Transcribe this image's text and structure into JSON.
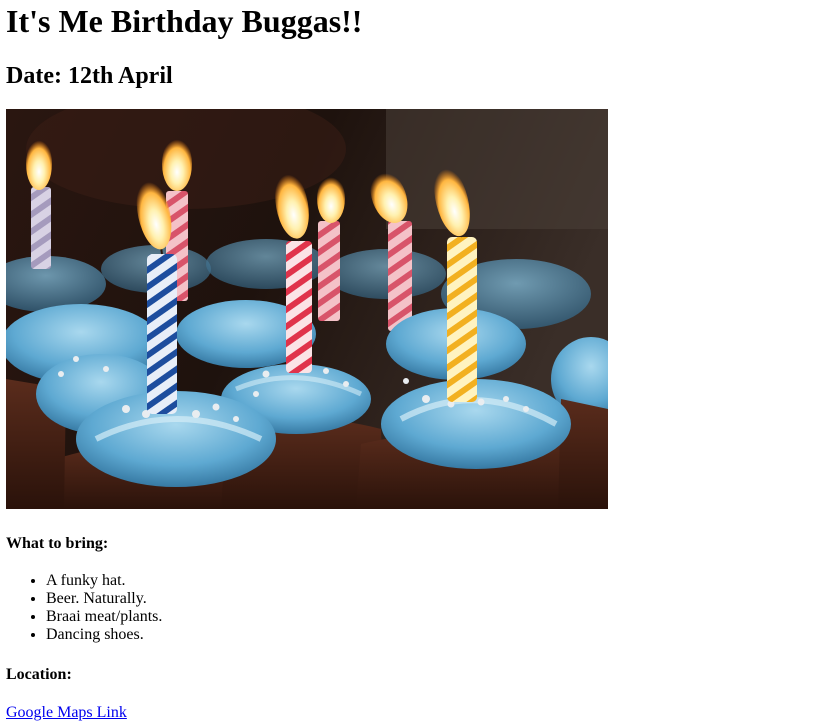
{
  "page": {
    "title": "It's Me Birthday Buggas!!",
    "date_heading": "Date: 12th April"
  },
  "image": {
    "description_icon": "birthday-cupcakes-candles-photo"
  },
  "bring": {
    "heading": "What to bring:",
    "items": [
      "A funky hat.",
      "Beer. Naturally.",
      "Braai meat/plants.",
      "Dancing shoes."
    ]
  },
  "location": {
    "heading": "Location:",
    "link_label": "Google Maps Link"
  },
  "colors": {
    "link": "#0000ee",
    "frosting": "#6fb6dc",
    "cake": "#4a2418"
  }
}
